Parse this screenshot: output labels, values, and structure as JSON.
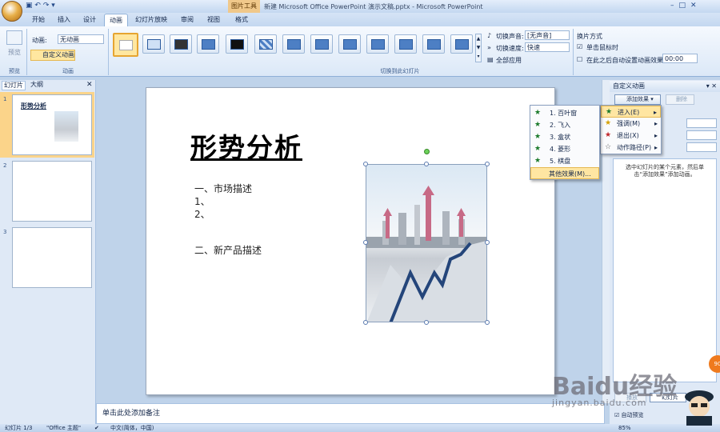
{
  "window": {
    "contextual_tab": "图片工具",
    "title": "新建 Microsoft Office PowerPoint 演示文稿.pptx - Microsoft PowerPoint"
  },
  "tabs": [
    "开始",
    "插入",
    "设计",
    "动画",
    "幻灯片放映",
    "审阅",
    "视图",
    "格式"
  ],
  "active_tab": "动画",
  "ribbon": {
    "preview_label": "预览",
    "preview_group": "预览",
    "animation_label": "动画:",
    "animation_value": "无动画",
    "custom_animation": "自定义动画",
    "animation_group": "动画",
    "transition_group": "切换到此幻灯片",
    "transition_sound_label": "切换声音:",
    "transition_sound_value": "[无声音]",
    "transition_speed_label": "切换速度:",
    "transition_speed_value": "快速",
    "apply_all": "全部应用",
    "advance_title": "换片方式",
    "on_click": "单击鼠标时",
    "auto_after": "在此之后自动设置动画效果:",
    "auto_time": "00:00"
  },
  "left_pane": {
    "tab_slides": "幻灯片",
    "tab_outline": "大纲",
    "thumbs": [
      {
        "num": "1",
        "title": "形势分析"
      },
      {
        "num": "2",
        "title": ""
      },
      {
        "num": "3",
        "title": ""
      }
    ]
  },
  "slide": {
    "title": "形势分析",
    "line1": "一、市场描述",
    "line2": "1、",
    "line3": "2、",
    "line4": "二、新产品描述"
  },
  "notes_placeholder": "单击此处添加备注",
  "right_pane": {
    "title": "自定义动画",
    "add_effect": "添加效果",
    "delete": "删除",
    "description": "选中幻灯片的某个元素，然后单击“添加效果”添加动画。",
    "play": "播放",
    "slideshow": "幻灯片",
    "auto_preview": "自动预览"
  },
  "add_effect_menu": [
    {
      "label": "进入(E)",
      "highlighted": true
    },
    {
      "label": "强调(M)",
      "highlighted": false
    },
    {
      "label": "退出(X)",
      "highlighted": false
    },
    {
      "label": "动作路径(P)",
      "highlighted": false
    }
  ],
  "entrance_menu": [
    {
      "label": "1. 百叶窗"
    },
    {
      "label": "2. 飞入"
    },
    {
      "label": "3. 盒状"
    },
    {
      "label": "4. 菱形"
    },
    {
      "label": "5. 棋盘"
    },
    {
      "label": "其他效果(M)..."
    }
  ],
  "status_bar": {
    "slide_pos": "幻灯片 1/3",
    "theme": "\"Office 主题\"",
    "language": "中文(简体，中国)",
    "zoom": "85%"
  },
  "watermark": {
    "text": "Baidu经验",
    "url": "jingyan.baidu.com"
  }
}
